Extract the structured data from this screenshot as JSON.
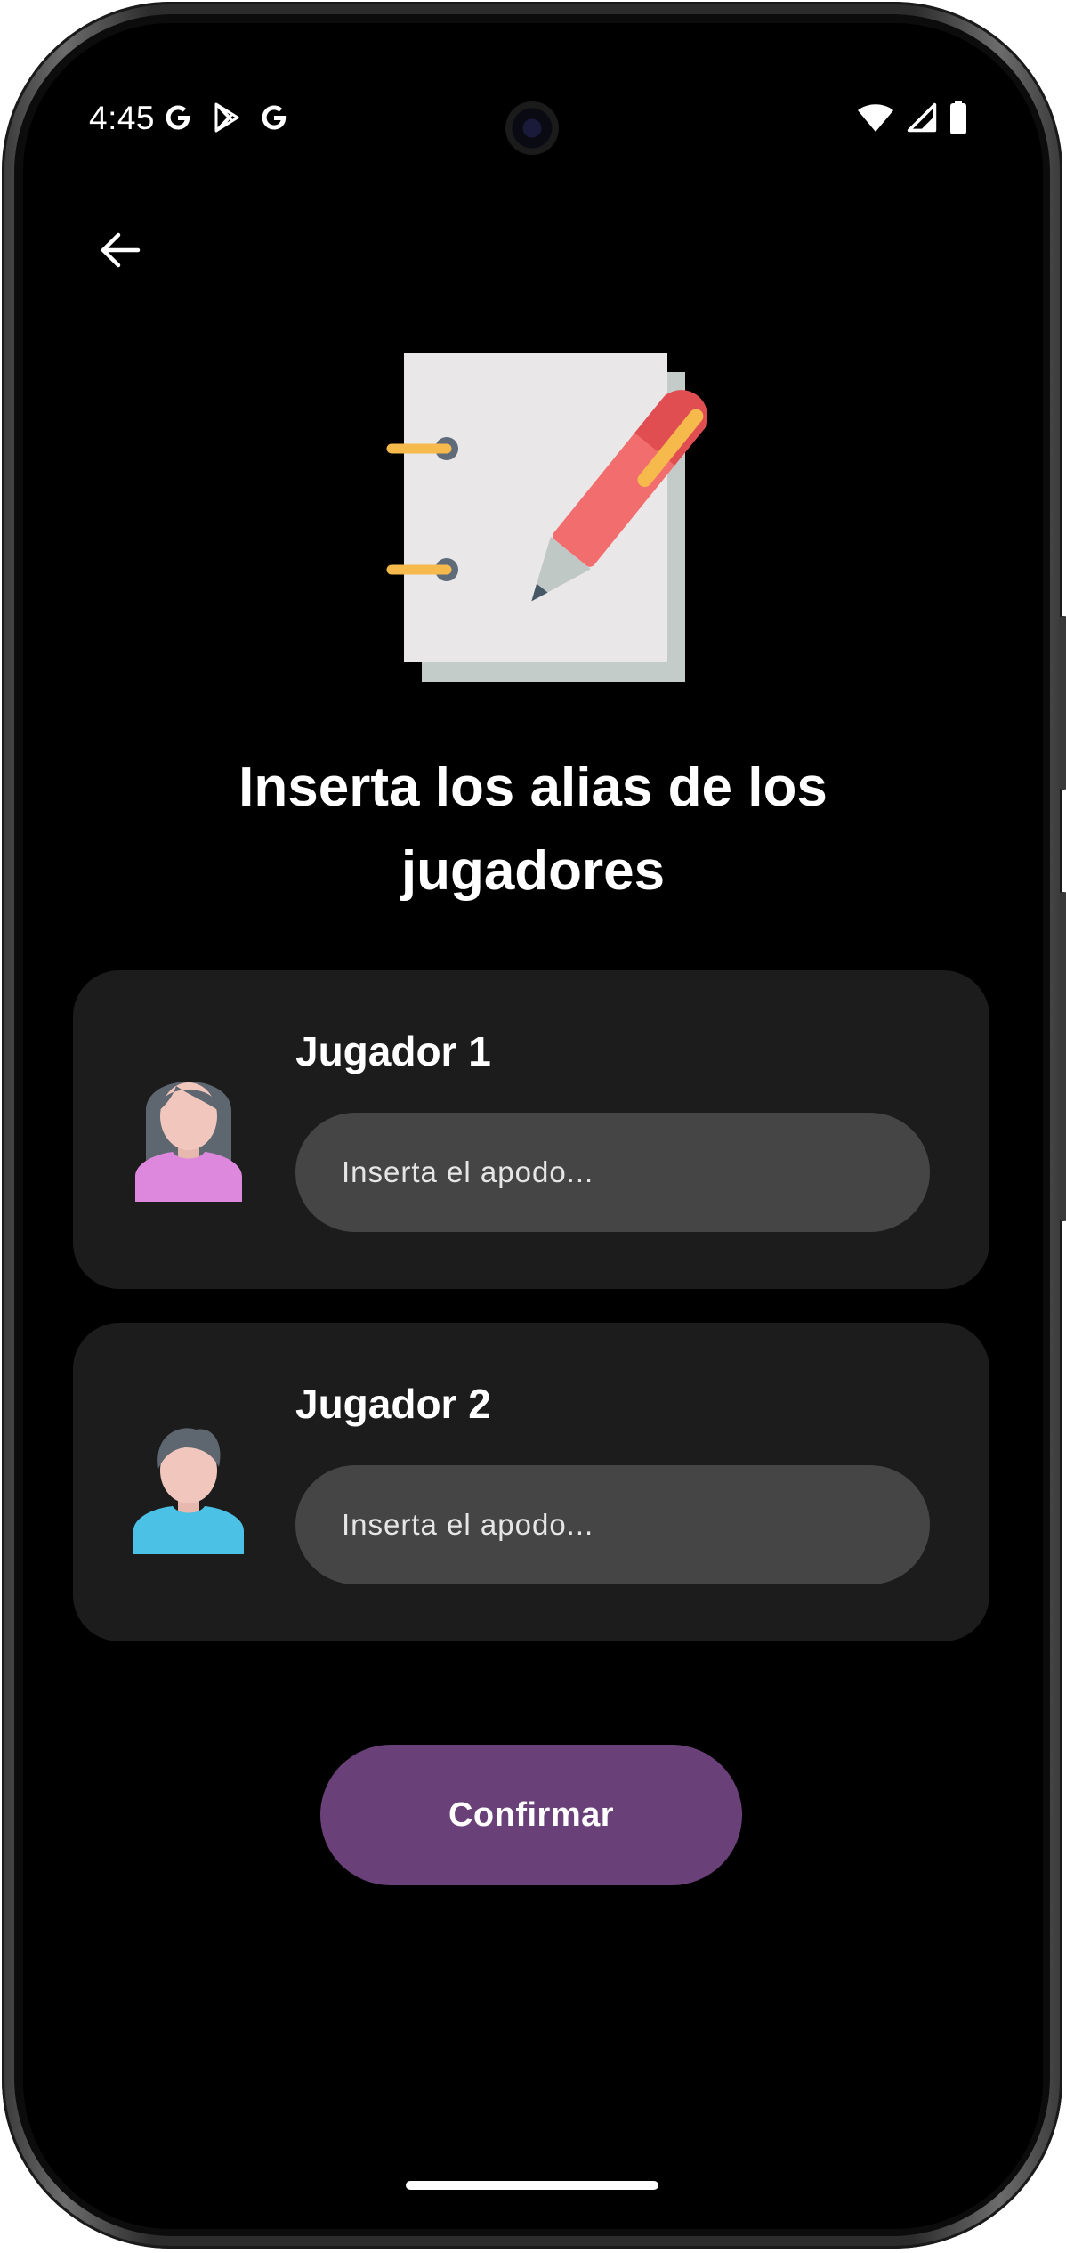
{
  "status_bar": {
    "time": "4:45",
    "notification_icons": [
      "google-icon",
      "play-store-icon",
      "google-icon"
    ],
    "system_icons": [
      "wifi-icon",
      "signal-icon",
      "battery-icon"
    ]
  },
  "app_bar": {
    "back_icon": "arrow-back-icon"
  },
  "illustration": {
    "icon": "notebook-pencil-icon"
  },
  "title": "Inserta los alias de los jugadores",
  "players": [
    {
      "label": "Jugador 1",
      "avatar_icon": "female-avatar-icon",
      "input_placeholder": "Inserta el apodo...",
      "input_value": ""
    },
    {
      "label": "Jugador 2",
      "avatar_icon": "male-avatar-icon",
      "input_placeholder": "Inserta el apodo...",
      "input_value": ""
    }
  ],
  "confirm_button": {
    "label": "Confirmar"
  },
  "colors": {
    "background": "#000000",
    "card": "#1c1c1c",
    "input": "#454545",
    "accent": "#6a4079",
    "text": "#ffffff"
  }
}
